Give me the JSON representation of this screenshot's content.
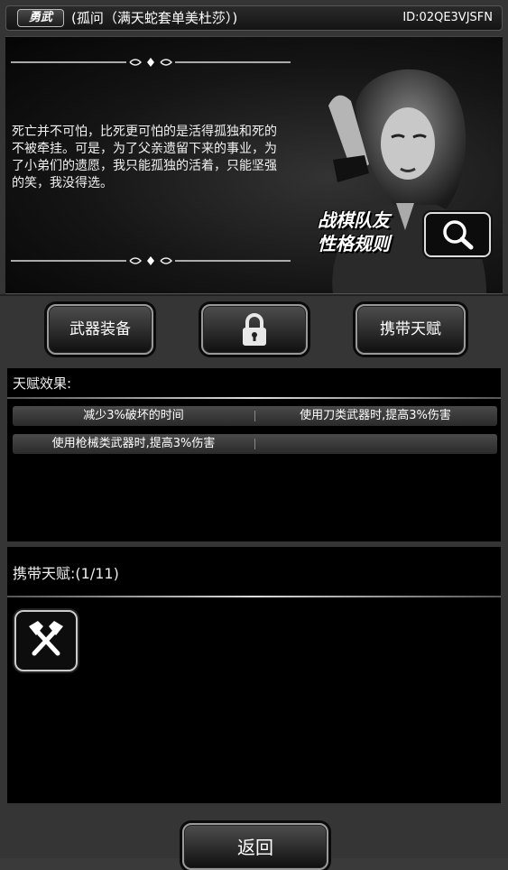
{
  "header": {
    "badge": "勇武",
    "title": "(孤问（满天蛇套单美杜莎）)",
    "id": "ID:02QE3VJSFN"
  },
  "story": {
    "text": "死亡并不可怕，比死更可怕的是活得孤独和死的不被牵挂。可是，为了父亲遗留下来的事业，为了小弟们的遗愿，我只能孤独的活着，只能坚强的笑，我没得选。",
    "rules_line1": "战棋队友",
    "rules_line2": "性格规则",
    "magnify_icon": "magnifier-icon",
    "portrait_icon": "character-portrait"
  },
  "tabs": {
    "weapons": "武器装备",
    "locked_icon": "lock-icon",
    "carry": "携带天赋"
  },
  "effects": {
    "title": "天赋效果:",
    "rows": [
      [
        "减少3%破坏的时间",
        "使用刀类武器时,提高3%伤害"
      ],
      [
        "使用枪械类武器时,提高3%伤害",
        ""
      ]
    ]
  },
  "carried": {
    "title": "携带天赋:(1/11)",
    "slot_icon": "crossed-axes-icon"
  },
  "footer": {
    "back": "返回"
  },
  "colors": {
    "panel_bg": "#000000",
    "frame_bg": "#353535",
    "button_border": "#999999"
  }
}
